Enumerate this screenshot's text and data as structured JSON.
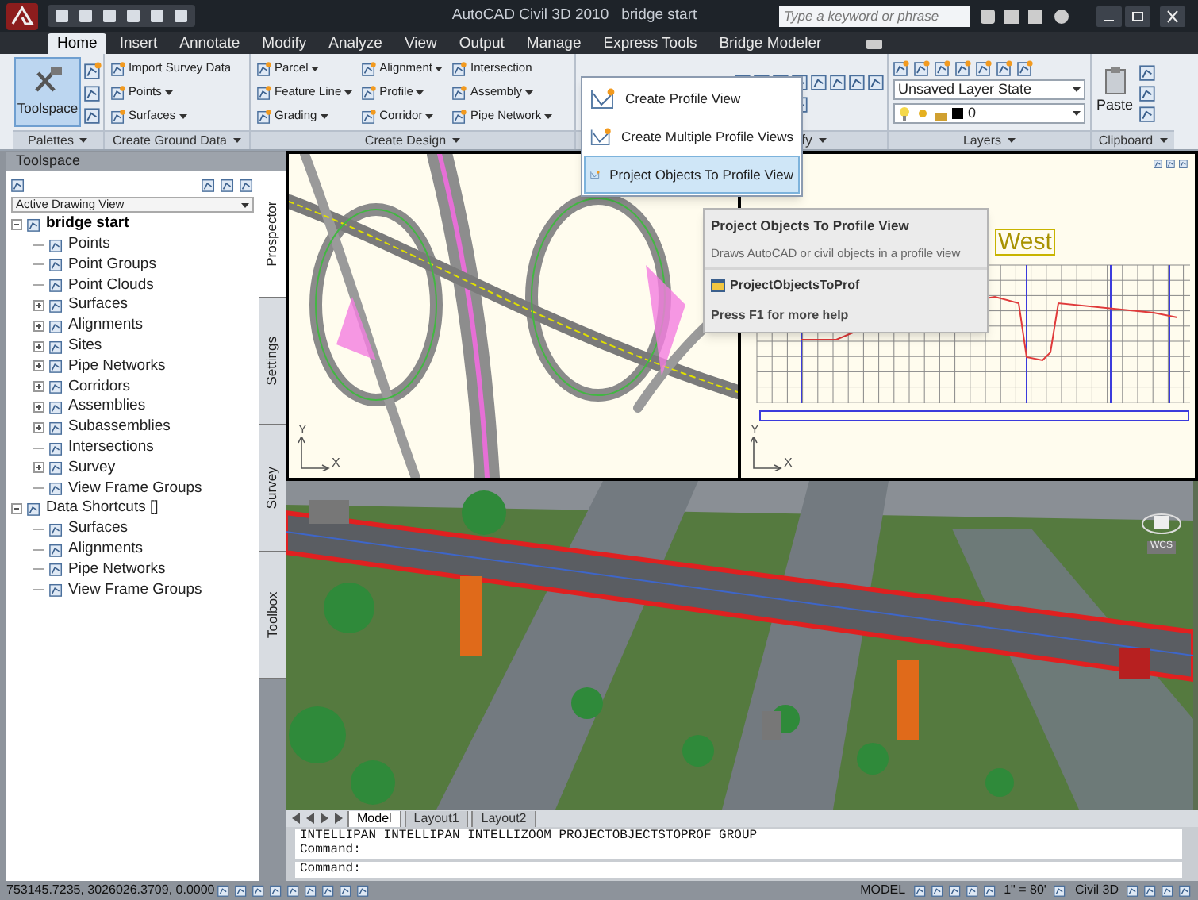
{
  "title_bar": {
    "app_title": "AutoCAD Civil 3D 2010",
    "document": "bridge start",
    "search": {
      "placeholder": "Type a keyword or phrase"
    }
  },
  "ribbon_tabs": [
    {
      "label": "Home",
      "selected": true
    },
    {
      "label": "Insert",
      "selected": false
    },
    {
      "label": "Annotate",
      "selected": false
    },
    {
      "label": "Modify",
      "selected": false
    },
    {
      "label": "Analyze",
      "selected": false
    },
    {
      "label": "View",
      "selected": false
    },
    {
      "label": "Output",
      "selected": false
    },
    {
      "label": "Manage",
      "selected": false
    },
    {
      "label": "Express Tools",
      "selected": false
    },
    {
      "label": "Bridge Modeler",
      "selected": false
    }
  ],
  "palettes_panel": {
    "title": "Palettes",
    "button": {
      "label": "Toolspace",
      "active": true
    }
  },
  "ground_panel": {
    "title": "Create Ground Data",
    "items": [
      {
        "label": "Import Survey Data",
        "dropdown": false
      },
      {
        "label": "Points",
        "dropdown": true
      },
      {
        "label": "Surfaces",
        "dropdown": true
      }
    ]
  },
  "design_panel": {
    "title": "Create Design",
    "columns": [
      [
        {
          "label": "Parcel",
          "dropdown": true
        },
        {
          "label": "Feature Line",
          "dropdown": true
        },
        {
          "label": "Grading",
          "dropdown": true
        }
      ],
      [
        {
          "label": "Alignment",
          "dropdown": true
        },
        {
          "label": "Profile",
          "dropdown": true
        },
        {
          "label": "Corridor",
          "dropdown": true
        }
      ],
      [
        {
          "label": "Intersection",
          "dropdown": false
        },
        {
          "label": "Assembly",
          "dropdown": true
        },
        {
          "label": "Pipe Network",
          "dropdown": true
        }
      ]
    ]
  },
  "modify_panel": {
    "title": "fy"
  },
  "layers_panel": {
    "title": "Layers",
    "layer_state": "Unsaved Layer State",
    "current_layer": "0"
  },
  "clipboard_panel": {
    "title": "Clipboard",
    "paste": "Paste"
  },
  "toolspace": {
    "title": "Toolspace",
    "view": "Active Drawing View",
    "tree": [
      {
        "label": "bridge start",
        "current": true,
        "children": [
          {
            "label": "Points",
            "expandable": false
          },
          {
            "label": "Point Groups",
            "expandable": false
          },
          {
            "label": "Point Clouds",
            "expandable": false
          },
          {
            "label": "Surfaces",
            "expandable": true
          },
          {
            "label": "Alignments",
            "expandable": true
          },
          {
            "label": "Sites",
            "expandable": true
          },
          {
            "label": "Pipe Networks",
            "expandable": true
          },
          {
            "label": "Corridors",
            "expandable": true
          },
          {
            "label": "Assemblies",
            "expandable": true
          },
          {
            "label": "Subassemblies",
            "expandable": true
          },
          {
            "label": "Intersections",
            "expandable": false
          },
          {
            "label": "Survey",
            "expandable": true
          },
          {
            "label": "View Frame Groups",
            "expandable": false
          }
        ]
      },
      {
        "label": "Data Shortcuts []",
        "current": false,
        "children": [
          {
            "label": "Surfaces",
            "expandable": false
          },
          {
            "label": "Alignments",
            "expandable": false
          },
          {
            "label": "Pipe Networks",
            "expandable": false
          },
          {
            "label": "View Frame Groups",
            "expandable": false
          }
        ]
      }
    ],
    "side_tabs": [
      {
        "label": "Prospector",
        "selected": true
      },
      {
        "label": "Settings",
        "selected": false
      },
      {
        "label": "Survey",
        "selected": false
      },
      {
        "label": "Toolbox",
        "selected": false
      }
    ]
  },
  "profile_menu": {
    "items": [
      {
        "label": "Create Profile View",
        "selected": false
      },
      {
        "label": "Create Multiple Profile Views",
        "selected": false
      },
      {
        "label": "Project Objects To Profile View",
        "selected": true
      }
    ]
  },
  "tooltip": {
    "title": "Project Objects To Profile View",
    "description": "Draws AutoCAD or civil objects in a profile view",
    "command": "ProjectObjectsToProf",
    "help": "Press F1 for more help"
  },
  "plan_viewport": {
    "ucs_labels": [
      "Y",
      "X"
    ]
  },
  "profile_viewport": {
    "label": "West",
    "ucs_labels": [
      "Y",
      "X"
    ]
  },
  "model_viewport": {
    "wcs_label": "WCS"
  },
  "layout_tabs": [
    {
      "label": "Model",
      "selected": true
    },
    {
      "label": "Layout1",
      "selected": false
    },
    {
      "label": "Layout2",
      "selected": false
    }
  ],
  "command_line": {
    "history": [
      "INTELLIPAN INTELLIPAN INTELLIZOOM PROJECTOBJECTSTOPROF GROUP",
      "Command:"
    ],
    "prompt": "Command:"
  },
  "status_bar": {
    "coordinates": "753145.7235, 3026026.3709, 0.0000",
    "space": "MODEL",
    "scale": "1\" = 80'",
    "workspace": "Civil 3D"
  }
}
